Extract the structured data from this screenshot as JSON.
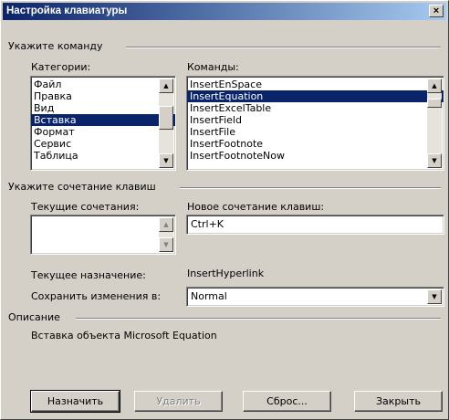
{
  "window": {
    "title": "Настройка клавиатуры",
    "close_glyph": "×"
  },
  "command_group": {
    "label": "Укажите команду",
    "categories": {
      "label": "Категории:",
      "items": [
        "Файл",
        "Правка",
        "Вид",
        "Вставка",
        "Формат",
        "Сервис",
        "Таблица"
      ],
      "selected": "Вставка"
    },
    "commands": {
      "label": "Команды:",
      "items": [
        "InsertEnSpace",
        "InsertEquation",
        "InsertExcelTable",
        "InsertField",
        "InsertFile",
        "InsertFootnote",
        "InsertFootnoteNow"
      ],
      "selected": "InsertEquation"
    }
  },
  "shortcut_group": {
    "label": "Укажите сочетание клавиш",
    "current_label": "Текущие сочетания:",
    "new_label": "Новое сочетание клавиш:",
    "new_value": "Ctrl+K",
    "assignment_label": "Текущее назначение:",
    "assignment_value": "InsertHyperlink",
    "save_label": "Сохранить изменения в:",
    "save_value": "Normal"
  },
  "description_group": {
    "label": "Описание",
    "text": "Вставка объекта Microsoft Equation"
  },
  "buttons": {
    "assign": "Назначить",
    "remove": "Удалить",
    "reset": "Сброс...",
    "close": "Закрыть"
  },
  "icons": {
    "scroll_up": "▲",
    "scroll_down": "▼",
    "dropdown": "▼"
  },
  "colors": {
    "dialog_bg": "#d4d0c8",
    "title_bar": "#0a246a",
    "selection": "#0a246a"
  }
}
